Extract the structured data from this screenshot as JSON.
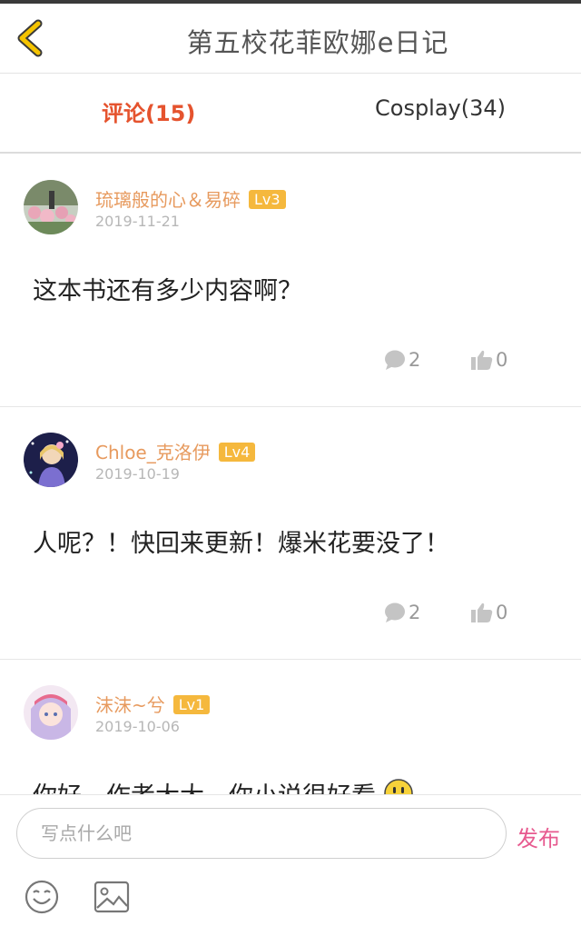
{
  "header": {
    "title": "第五校花菲欧娜e日记",
    "back_icon": "chevron-left-icon",
    "accent": "#f5c400"
  },
  "tabs": [
    {
      "label": "评论(15)",
      "active": true
    },
    {
      "label": "Cosplay(34)",
      "active": false
    }
  ],
  "comments": [
    {
      "username": "琉璃般的心＆易碎",
      "level": "Lv3",
      "date": "2019-11-21",
      "text": "这本书还有多少内容啊？",
      "replies": "2",
      "likes": "0"
    },
    {
      "username": "Chloe_克洛伊",
      "level": "Lv4",
      "date": "2019-10-19",
      "text": "人呢？！快回来更新！爆米花要没了！",
      "replies": "2",
      "likes": "0"
    },
    {
      "username": "沫沫~兮",
      "level": "Lv1",
      "date": "2019-10-06",
      "text": "你好，作者大大，你小说很好看"
    }
  ],
  "composer": {
    "placeholder": "写点什么吧",
    "send_label": "发布",
    "emoji_icon": "smiley-icon",
    "image_icon": "image-icon"
  },
  "colors": {
    "username": "#e79a5e",
    "level_badge": "#f5b83d",
    "active_tab": "#e5532e",
    "send": "#e75a8f"
  }
}
